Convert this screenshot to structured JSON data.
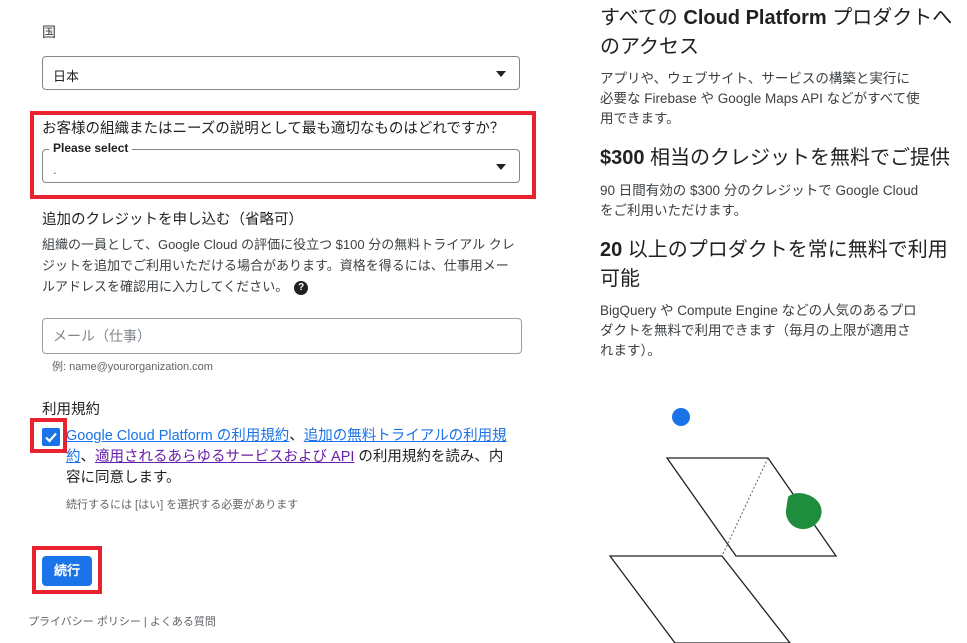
{
  "form": {
    "country_label": "国",
    "country_value": "日本",
    "org_question": "お客様の組織またはニーズの説明として最も適切なものはどれですか？",
    "org_select_label": "Please select",
    "org_select_value": ".",
    "credit_title": "追加のクレジットを申し込む（省略可）",
    "credit_desc_1": "組織の一員として、Google Cloud の評価に役立つ $100 分の無料トライアル クレ",
    "credit_desc_2": "ジットを追加でご利用いただける場合があります。資格を得るには、仕事用メー",
    "credit_desc_3": "ルアドレスを確認用に入力してください。",
    "help_icon_glyph": "?",
    "email_placeholder": "メール（仕事）",
    "email_value": "",
    "email_hint": "例: name@yourorganization.com",
    "terms_label": "利用規約",
    "terms_checked": true,
    "terms_link1": "Google Cloud Platform の利用規約",
    "terms_sep1": "、",
    "terms_link2_a": "追加の無料トライアルの利用規",
    "terms_link2_b": "約",
    "terms_sep2": "、",
    "terms_link3": "適用されるあらゆるサービスおよび API",
    "terms_rest_a": " の利用規約を読み、内",
    "terms_rest_b": "容に同意します。",
    "terms_hint": "続行するには [はい] を選択する必要があります",
    "continue_label": "続行"
  },
  "footer": {
    "privacy": "プライバシー ポリシー",
    "sep": " | ",
    "faq": "よくある質問"
  },
  "right": {
    "h1_a": "すべての",
    "h1_b": " Cloud Platform",
    "h1_c": " プロダクトへ",
    "h1_d": "のアクセス",
    "p1_a": "アプリや、ウェブサイト、サービスの構築と実行に",
    "p1_b": "必要な Firebase や Google Maps API などがすべて使",
    "p1_c": "用できます。",
    "h2_a": "$300",
    "h2_b": " 相当のクレジットを無料でご提供",
    "p2_a": "90 日間有効の $300 分のクレジットで Google Cloud",
    "p2_b": "をご利用いただけます。",
    "h3_a": "20",
    "h3_b": " 以上のプロダクトを常に無料で利用",
    "h3_c": "可能",
    "p3_a": "BigQuery や Compute Engine などの人気のあるプロ",
    "p3_b": "ダクトを無料で利用できます（毎月の上限が適用さ",
    "p3_c": "れます）。"
  },
  "colors": {
    "accent": "#1a73e8",
    "highlight_red": "#e8222e",
    "blob_blue": "#1a73e8",
    "blob_green": "#1e8e3e"
  }
}
